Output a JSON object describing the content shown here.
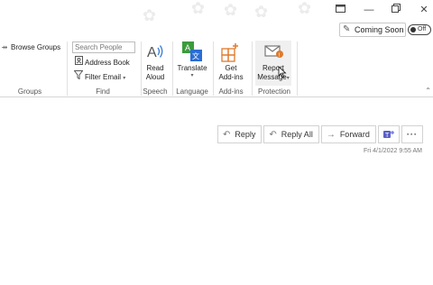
{
  "window": {
    "controls": [
      "dock-icon",
      "minimize-icon",
      "restore-icon",
      "close-icon"
    ]
  },
  "coming_soon": {
    "label": "Coming Soon",
    "toggle_label": "Off"
  },
  "ribbon": {
    "groups": {
      "label": "Groups",
      "browse_groups": "Browse Groups"
    },
    "find": {
      "label": "Find",
      "search_placeholder": "Search People",
      "address_book": "Address Book",
      "filter_email": "Filter Email"
    },
    "speech": {
      "label": "Speech",
      "read_aloud_line1": "Read",
      "read_aloud_line2": "Aloud"
    },
    "language": {
      "label": "Language",
      "translate": "Translate"
    },
    "addins": {
      "label": "Add-ins",
      "get_line1": "Get",
      "get_line2": "Add-ins"
    },
    "protection": {
      "label": "Protection",
      "report_line1": "Report",
      "report_line2": "Message"
    }
  },
  "message_actions": {
    "reply": "Reply",
    "reply_all": "Reply All",
    "forward": "Forward",
    "more": "···"
  },
  "message": {
    "date": "Fri 4/1/2022 9:55 AM"
  },
  "colors": {
    "teams": "#5b5fc7",
    "translate_green": "#3c9b3c",
    "translate_blue": "#2a6dd4",
    "addins_orange": "#e07a2c"
  }
}
